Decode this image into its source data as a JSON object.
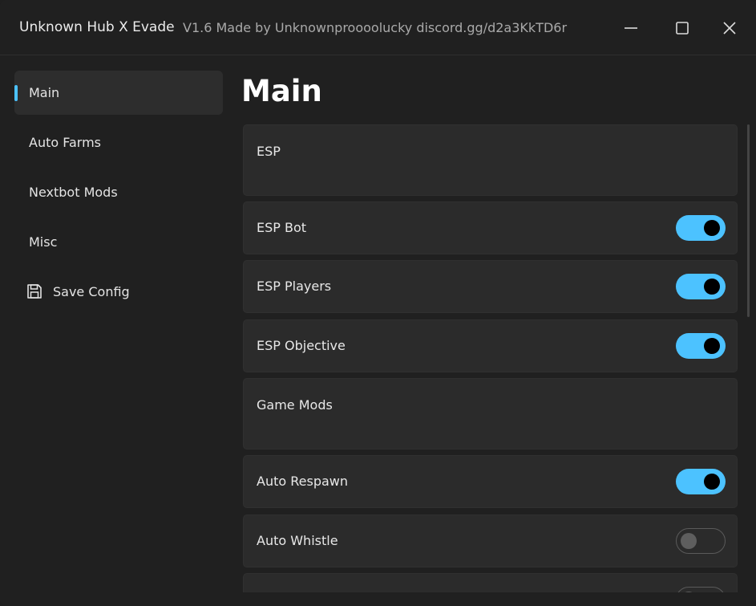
{
  "window": {
    "title": "Unknown Hub X Evade",
    "subtitle": "V1.6 Made by Unknownproooolucky discord.gg/d2a3KkTD6r",
    "controls": [
      "minimize-icon",
      "maximize-icon",
      "close-icon"
    ]
  },
  "sidebar": {
    "items": [
      {
        "label": "Main",
        "active": true
      },
      {
        "label": "Auto Farms",
        "active": false
      },
      {
        "label": "Nextbot Mods",
        "active": false
      },
      {
        "label": "Misc",
        "active": false
      },
      {
        "label": "Save Config",
        "icon": "save-icon",
        "active": false
      }
    ]
  },
  "main": {
    "title": "Main",
    "rows": [
      {
        "type": "section",
        "label": "ESP"
      },
      {
        "type": "toggle",
        "label": "ESP Bot",
        "value": true
      },
      {
        "type": "toggle",
        "label": "ESP Players",
        "value": true
      },
      {
        "type": "toggle",
        "label": "ESP Objective",
        "value": true
      },
      {
        "type": "section",
        "label": "Game Mods"
      },
      {
        "type": "toggle",
        "label": "Auto Respawn",
        "value": true
      },
      {
        "type": "toggle",
        "label": "Auto Whistle",
        "value": false
      },
      {
        "type": "toggle",
        "label": "",
        "value": false
      }
    ]
  },
  "colors": {
    "accent": "#4cc2ff",
    "background": "#202020",
    "card": "#2b2b2b"
  }
}
